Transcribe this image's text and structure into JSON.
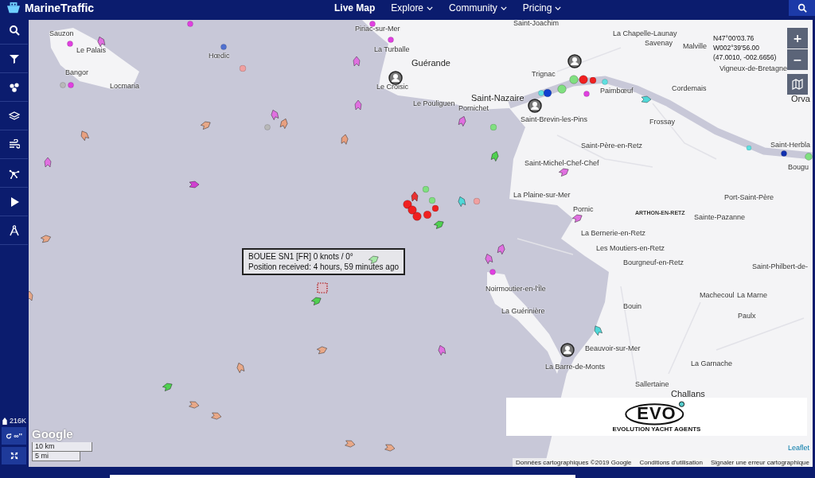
{
  "header": {
    "brand": "MarineTraffic",
    "nav": [
      {
        "label": "Live Map",
        "selected": true,
        "dropdown": false
      },
      {
        "label": "Explore",
        "selected": false,
        "dropdown": true
      },
      {
        "label": "Community",
        "selected": false,
        "dropdown": true
      },
      {
        "label": "Pricing",
        "selected": false,
        "dropdown": true
      }
    ]
  },
  "sidebar": {
    "vessel_count": "216K",
    "refresh_label": "∞''"
  },
  "map": {
    "places": [
      {
        "name": "Sauzon",
        "kind": "town"
      },
      {
        "name": "Le Palais",
        "kind": "town"
      },
      {
        "name": "Bangor",
        "kind": "town"
      },
      {
        "name": "Locmaria",
        "kind": "town"
      },
      {
        "name": "Hœdic",
        "kind": "town"
      },
      {
        "name": "Piriac-sur-Mer",
        "kind": "town"
      },
      {
        "name": "La Turballe",
        "kind": "town"
      },
      {
        "name": "Guérande",
        "kind": "city"
      },
      {
        "name": "Le Croisic",
        "kind": "town"
      },
      {
        "name": "Le Pouliguen",
        "kind": "town"
      },
      {
        "name": "Pornichet",
        "kind": "town"
      },
      {
        "name": "Saint-Joachim",
        "kind": "town"
      },
      {
        "name": "La Chapelle-Launay",
        "kind": "town"
      },
      {
        "name": "Savenay",
        "kind": "town"
      },
      {
        "name": "Malville",
        "kind": "town"
      },
      {
        "name": "Vigneux-de-Bretagne",
        "kind": "town"
      },
      {
        "name": "Trignac",
        "kind": "town"
      },
      {
        "name": "Saint-Nazaire",
        "kind": "city"
      },
      {
        "name": "Paimbœuf",
        "kind": "town"
      },
      {
        "name": "Cordemais",
        "kind": "town"
      },
      {
        "name": "Orva",
        "kind": "city"
      },
      {
        "name": "Saint-Brevin-les-Pins",
        "kind": "town"
      },
      {
        "name": "Frossay",
        "kind": "town"
      },
      {
        "name": "Saint-Herbla",
        "kind": "town"
      },
      {
        "name": "Bougu",
        "kind": "town"
      },
      {
        "name": "Saint-Père-en-Retz",
        "kind": "town"
      },
      {
        "name": "Saint-Michel-Chef-Chef",
        "kind": "town"
      },
      {
        "name": "La Plaine-sur-Mer",
        "kind": "town"
      },
      {
        "name": "Port-Saint-Père",
        "kind": "town"
      },
      {
        "name": "Pornic",
        "kind": "town"
      },
      {
        "name": "ARTHON-EN-RETZ",
        "kind": "district"
      },
      {
        "name": "Sainte-Pazanne",
        "kind": "town"
      },
      {
        "name": "La Bernerie-en-Retz",
        "kind": "town"
      },
      {
        "name": "Les Moutiers-en-Retz",
        "kind": "town"
      },
      {
        "name": "Bourgneuf-en-Retz",
        "kind": "town"
      },
      {
        "name": "Saint-Philbert-de-",
        "kind": "town"
      },
      {
        "name": "Noirmoutier-en-l'Île",
        "kind": "town"
      },
      {
        "name": "La Guérinière",
        "kind": "town"
      },
      {
        "name": "Machecoul",
        "kind": "town"
      },
      {
        "name": "La Marne",
        "kind": "town"
      },
      {
        "name": "Paulx",
        "kind": "town"
      },
      {
        "name": "Bouin",
        "kind": "town"
      },
      {
        "name": "Beauvoir-sur-Mer",
        "kind": "town"
      },
      {
        "name": "La Barre-de-Monts",
        "kind": "town"
      },
      {
        "name": "La Garnache",
        "kind": "town"
      },
      {
        "name": "Sallertaine",
        "kind": "town"
      },
      {
        "name": "Challans",
        "kind": "city"
      }
    ],
    "markers": [
      {
        "kind": "ship",
        "color": "#e070e0"
      },
      {
        "kind": "ship",
        "color": "#d040d0"
      },
      {
        "kind": "ship",
        "color": "#e070e0"
      },
      {
        "kind": "ship",
        "color": "#e070e0"
      },
      {
        "kind": "ship",
        "color": "#e070e0"
      },
      {
        "kind": "ship",
        "color": "#e070e0"
      },
      {
        "kind": "ship",
        "color": "#e070e0"
      },
      {
        "kind": "ship",
        "color": "#e070e0"
      },
      {
        "kind": "ship",
        "color": "#e070e0"
      },
      {
        "kind": "ship",
        "color": "#e070e0"
      },
      {
        "kind": "ship",
        "color": "#e070e0"
      },
      {
        "kind": "ship",
        "color": "#e070e0"
      },
      {
        "kind": "ship",
        "color": "#e8a888"
      },
      {
        "kind": "ship",
        "color": "#e8a080"
      },
      {
        "kind": "ship",
        "color": "#e8a080"
      },
      {
        "kind": "ship",
        "color": "#e8a080"
      },
      {
        "kind": "ship",
        "color": "#e8a888"
      },
      {
        "kind": "ship",
        "color": "#e8a888"
      },
      {
        "kind": "ship",
        "color": "#e8a888"
      },
      {
        "kind": "ship",
        "color": "#e8a888"
      },
      {
        "kind": "ship",
        "color": "#e8a888"
      },
      {
        "kind": "ship",
        "color": "#e8a888"
      },
      {
        "kind": "ship",
        "color": "#e8a888"
      },
      {
        "kind": "ship",
        "color": "#e8a888"
      },
      {
        "kind": "ship",
        "color": "#50d050"
      },
      {
        "kind": "ship",
        "color": "#50d050"
      },
      {
        "kind": "ship",
        "color": "#50d050"
      },
      {
        "kind": "ship",
        "color": "#50d050"
      },
      {
        "kind": "ship",
        "color": "#a8e8a8"
      },
      {
        "kind": "ship",
        "color": "#e83030"
      },
      {
        "kind": "ship",
        "color": "#50d8d8"
      },
      {
        "kind": "ship",
        "color": "#50d8d8"
      },
      {
        "kind": "ship",
        "color": "#50d8d8"
      },
      {
        "kind": "dot",
        "color": "#e040e0"
      },
      {
        "kind": "dot",
        "color": "#e040e0"
      },
      {
        "kind": "dot",
        "color": "#e040e0"
      },
      {
        "kind": "dot",
        "color": "#e040e0"
      },
      {
        "kind": "dot",
        "color": "#e040e0"
      },
      {
        "kind": "dot",
        "color": "#b8b8b8"
      },
      {
        "kind": "dot",
        "color": "#b8b8b8"
      },
      {
        "kind": "dot",
        "color": "#f0a0a0"
      },
      {
        "kind": "dot",
        "color": "#f0a0a0"
      },
      {
        "kind": "dot",
        "color": "#5070d0"
      },
      {
        "kind": "dot",
        "color": "#1030b0"
      },
      {
        "kind": "dot",
        "color": "#80e080"
      },
      {
        "kind": "dot",
        "color": "#80e080"
      },
      {
        "kind": "dot",
        "color": "#80e080"
      },
      {
        "kind": "dot",
        "color": "#80e080"
      },
      {
        "kind": "dot",
        "color": "#80e080"
      },
      {
        "kind": "dot",
        "color": "#80e080"
      },
      {
        "kind": "dot",
        "color": "#f02020"
      },
      {
        "kind": "dot",
        "color": "#f02020"
      },
      {
        "kind": "dot",
        "color": "#f02020"
      },
      {
        "kind": "dot",
        "color": "#f02020"
      },
      {
        "kind": "dot",
        "color": "#f02020"
      },
      {
        "kind": "dot",
        "color": "#f02020"
      },
      {
        "kind": "dot",
        "color": "#f02020"
      },
      {
        "kind": "dot",
        "color": "#60e0e0"
      },
      {
        "kind": "dot",
        "color": "#60e0e0"
      },
      {
        "kind": "dot",
        "color": "#60e0e0"
      },
      {
        "kind": "dot",
        "color": "#e040e0"
      },
      {
        "kind": "dot",
        "color": "#e040e0"
      },
      {
        "kind": "dot",
        "color": "#1040d0"
      },
      {
        "kind": "station"
      },
      {
        "kind": "station"
      },
      {
        "kind": "station"
      },
      {
        "kind": "station"
      },
      {
        "kind": "buoy"
      }
    ],
    "coordinates": [
      "N47°00'03.76",
      "W002°39'56.00",
      "(47.0010, -002.6656)"
    ],
    "zoom_in": "+",
    "zoom_out": "−",
    "tooltip": [
      "BOUEE SN1 [FR] 0 knots / 0°",
      "Position received: 4 hours, 59 minutes ago"
    ],
    "logo": {
      "text": "EVO",
      "tagline": "EVOLUTION YACHT AGENTS"
    },
    "google": "Google",
    "scale": [
      "10 km",
      "5 mi"
    ],
    "leaflet": "Leaflet",
    "attribution": [
      "Données cartographiques ©2019 Google",
      "Conditions d'utilisation",
      "Signaler une erreur cartographique"
    ]
  }
}
